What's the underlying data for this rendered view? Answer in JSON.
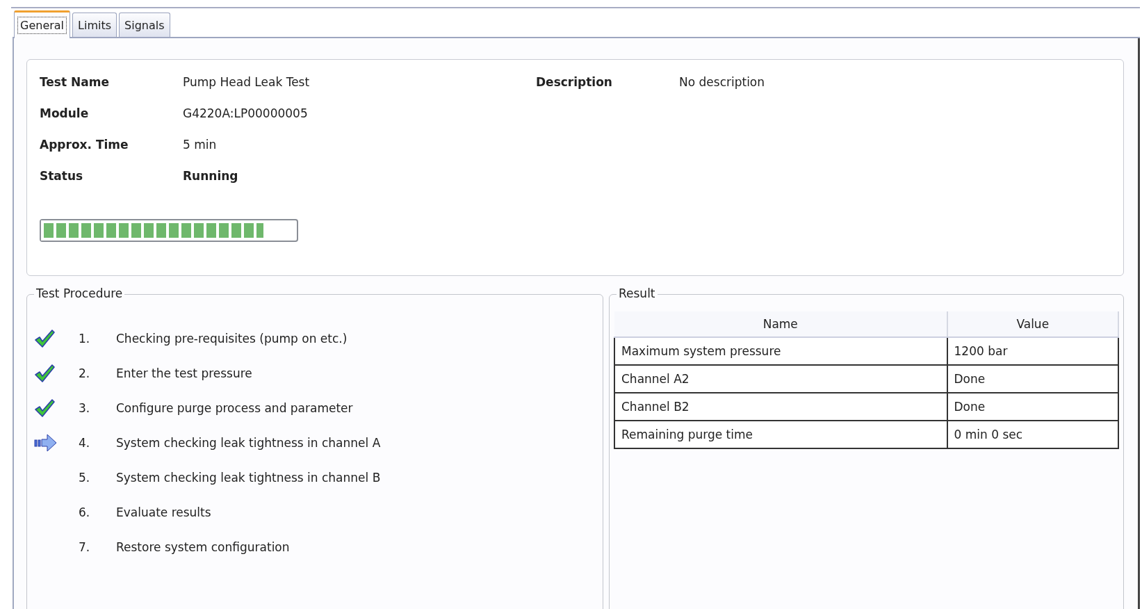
{
  "tabs": [
    {
      "label": "General",
      "selected": true
    },
    {
      "label": "Limits",
      "selected": false
    },
    {
      "label": "Signals",
      "selected": false
    }
  ],
  "test_info": {
    "fields": [
      {
        "label": "Test Name",
        "value": "Pump Head Leak Test",
        "kind": "plain"
      },
      {
        "label": "Module",
        "value": "G4220A:LP00000005",
        "kind": "plain"
      },
      {
        "label": "Approx. Time",
        "value": "5 min",
        "kind": "plain"
      },
      {
        "label": "Status",
        "value": "Running",
        "kind": "status"
      }
    ],
    "description": {
      "label": "Description",
      "value": "No description"
    },
    "progress": {
      "level": 0.87
    }
  },
  "procedure": {
    "title": "Test Procedure",
    "steps": [
      {
        "number": "1.",
        "text": "Checking pre-requisites (pump on etc.)",
        "kind": "done"
      },
      {
        "number": "2.",
        "text": "Enter the test pressure",
        "kind": "done"
      },
      {
        "number": "3.",
        "text": "Configure purge process and parameter",
        "kind": "done"
      },
      {
        "number": "4.",
        "text": "System checking leak tightness in channel A",
        "kind": "current"
      },
      {
        "number": "5.",
        "text": "System checking leak tightness in channel B",
        "kind": "pending"
      },
      {
        "number": "6.",
        "text": "Evaluate results",
        "kind": "pending"
      },
      {
        "number": "7.",
        "text": "Restore system configuration",
        "kind": "pending"
      }
    ]
  },
  "result": {
    "title": "Result",
    "columns": [
      "Name",
      "Value"
    ],
    "rows": [
      [
        "Maximum system pressure",
        "1200 bar"
      ],
      [
        "Channel A2",
        "Done"
      ],
      [
        "Channel B2",
        "Done"
      ],
      [
        "Remaining purge time",
        "0 min 0 sec"
      ]
    ]
  }
}
